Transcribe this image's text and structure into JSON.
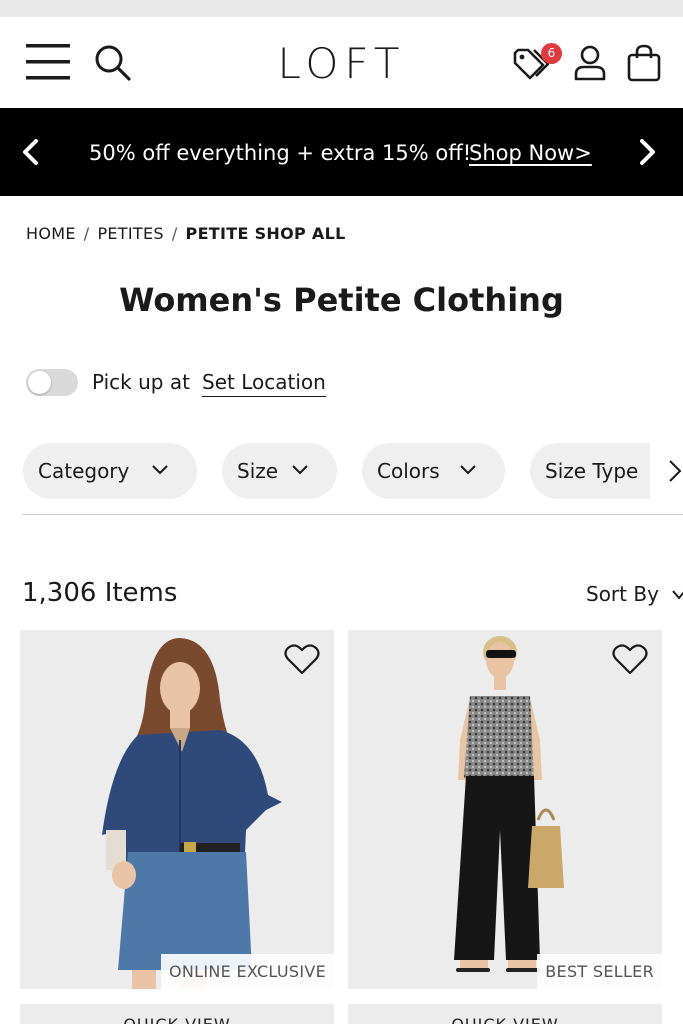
{
  "brand": {
    "logo": "LOFT"
  },
  "header": {
    "offers_count": "6"
  },
  "promo": {
    "message": "50% off everything + extra 15% off!",
    "link": "Shop Now>"
  },
  "breadcrumb": {
    "items": [
      "HOME",
      "PETITES",
      "PETITE SHOP ALL"
    ],
    "separator": "/"
  },
  "page": {
    "title": "Women's Petite Clothing"
  },
  "pickup": {
    "label": "Pick up at",
    "link": "Set Location",
    "enabled": false
  },
  "filters": {
    "chips": [
      {
        "label": "Category"
      },
      {
        "label": "Size"
      },
      {
        "label": "Colors"
      },
      {
        "label": "Size Type"
      }
    ]
  },
  "results": {
    "count_label": "1,306 Items",
    "sort_label": "Sort By"
  },
  "products": [
    {
      "badge": "ONLINE EXCLUSIVE",
      "quick_view": "QUICK VIEW"
    },
    {
      "badge": "BEST SELLER",
      "quick_view": "QUICK VIEW"
    }
  ],
  "colors": {
    "promo_bg": "#000000",
    "badge_red": "#e03a3e",
    "chip_bg": "#efefef",
    "tile_bg": "#ececec"
  },
  "icons": [
    "menu-icon",
    "search-icon",
    "tag-icon",
    "user-icon",
    "bag-icon",
    "chevron-left-icon",
    "chevron-right-icon",
    "chevron-down-icon",
    "heart-icon"
  ]
}
